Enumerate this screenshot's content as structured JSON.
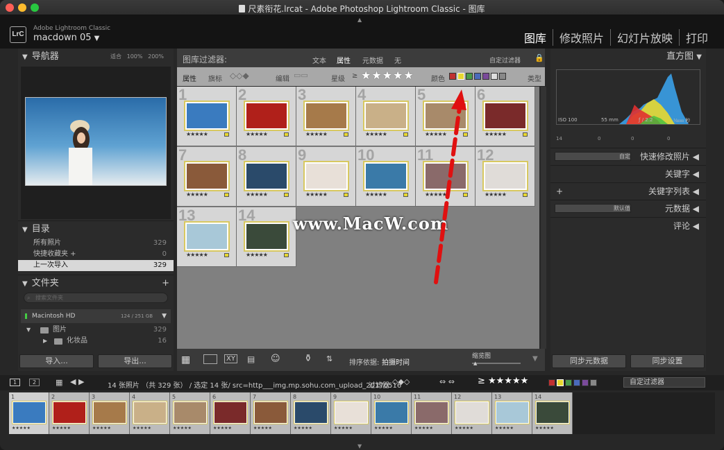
{
  "window": {
    "title": "尺素衔花.lrcat - Adobe Photoshop Lightroom Classic - 图库"
  },
  "branding": {
    "line1": "Adobe Lightroom Classic",
    "line2": "macdown 05",
    "logo": "LrC"
  },
  "modules": [
    "图库",
    "修改照片",
    "幻灯片放映",
    "打印"
  ],
  "left": {
    "navigator": {
      "title": "导航器",
      "zoom": [
        "适合",
        "100%",
        "200%"
      ]
    },
    "catalog": {
      "title": "目录",
      "items": [
        {
          "label": "所有照片",
          "count": "329"
        },
        {
          "label": "快捷收藏夹 +",
          "count": "0"
        },
        {
          "label": "上一次导入",
          "count": "329"
        }
      ]
    },
    "folders": {
      "title": "文件夹",
      "search_placeholder": "搜索文件夹",
      "volume": {
        "label": "Macintosh HD",
        "size": "124 / 251 GB"
      },
      "items": [
        {
          "label": "图片",
          "count": "329"
        },
        {
          "label": "化妆品",
          "count": "16"
        }
      ]
    },
    "import_label": "导入...",
    "export_label": "导出..."
  },
  "filter": {
    "title": "图库过滤器:",
    "tabs": [
      "文本",
      "属性",
      "元数据",
      "无"
    ],
    "preset": "自定过滤器",
    "attr_label": "属性",
    "flag_label": "旗标",
    "edit_label": "编辑",
    "rating_label": "星级",
    "color_label": "颜色",
    "type_label": "类型"
  },
  "grid": {
    "cells": [
      {
        "n": "1",
        "color": "#3a7bbf"
      },
      {
        "n": "2",
        "color": "#b0201a"
      },
      {
        "n": "3",
        "color": "#a67a4a"
      },
      {
        "n": "4",
        "color": "#c9b088"
      },
      {
        "n": "5",
        "color": "#a88a6a"
      },
      {
        "n": "6",
        "color": "#7a2a2a"
      },
      {
        "n": "7",
        "color": "#8a5a3a"
      },
      {
        "n": "8",
        "color": "#2a4a6a"
      },
      {
        "n": "9",
        "color": "#e8e0d8"
      },
      {
        "n": "10",
        "color": "#3a7aa8"
      },
      {
        "n": "11",
        "color": "#8a6a6a"
      },
      {
        "n": "12",
        "color": "#e0dcd8"
      },
      {
        "n": "13",
        "color": "#a8c8d8"
      },
      {
        "n": "14",
        "color": "#3a4a3a"
      }
    ],
    "stars": "★★★★★"
  },
  "watermark": "www.MacW.com",
  "toolbar": {
    "sort_label": "排序依据:",
    "sort_value": "拍摄时间",
    "thumb_label": "缩览图"
  },
  "right": {
    "histogram_title": "直方图",
    "iso": "ISO 100",
    "focal": "55 mm",
    "aperture": "ƒ / 2.2",
    "shutter": "¹⁄₄₀₀₀ 秒",
    "count_a": "14",
    "count_b": "0",
    "count_c": "0",
    "count_d": "0",
    "quick_title": "快速修改照片",
    "quick_select": "自定",
    "keywords": "关键字",
    "keywordlist": "关键字列表",
    "metadata": "元数据",
    "metadata_select": "默认值",
    "comments": "评论",
    "sync_meta": "同步元数据",
    "sync_settings": "同步设置"
  },
  "filmstrip": {
    "pages": [
      "1",
      "2"
    ],
    "info": "14 张照片 （共 329 张） / 选定 14 张/ src=http___img.mp.sohu.com_upload_20170516",
    "filter_label": "过滤器:",
    "filter_preset": "自定过滤器"
  },
  "colors": {
    "accent": "#e8d830",
    "arrow": "#e01010"
  }
}
